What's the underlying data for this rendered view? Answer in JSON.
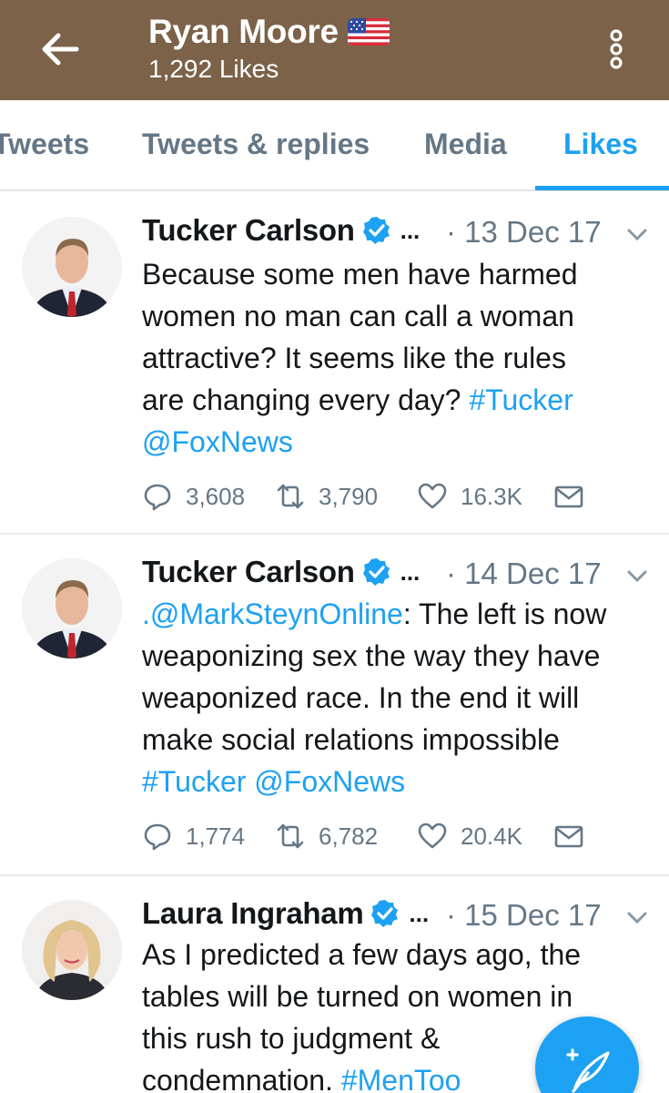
{
  "header": {
    "title": "Ryan Moore",
    "subtitle": "1,292 Likes",
    "flag_icon": "us-flag-emoji",
    "back_icon": "arrow-left-icon",
    "more_icon": "kebab-menu-icon",
    "background_color": "#7b6248"
  },
  "tabs": [
    {
      "label": "Tweets",
      "active": false
    },
    {
      "label": "Tweets & replies",
      "active": false
    },
    {
      "label": "Media",
      "active": false
    },
    {
      "label": "Likes",
      "active": true
    }
  ],
  "colors": {
    "accent": "#1da1f2",
    "muted": "#657786",
    "text": "#14171a"
  },
  "tweets": [
    {
      "author": "Tucker Carlson",
      "verified": true,
      "truncation": "...",
      "date": "· 13 Dec 17",
      "text_lines": [
        "Because some men have harmed",
        "women no man can call a woman",
        "attractive? It seems like the rules",
        "are changing every day? "
      ],
      "hashtag": "#Tucker",
      "mention": "@FoxNews",
      "replies": "3,608",
      "retweets": "3,790",
      "likes": "16.3K"
    },
    {
      "author": "Tucker Carlson",
      "verified": true,
      "truncation": "...",
      "date": "· 14 Dec 17",
      "lead_mention": ".@MarkSteynOnline",
      "text_lines": [
        ": The left is now",
        "weaponizing sex the way they have",
        "weaponized race. In the end it will",
        "make social relations impossible"
      ],
      "hashtag": "#Tucker",
      "mention": "@FoxNews",
      "replies": "1,774",
      "retweets": "6,782",
      "likes": "20.4K"
    },
    {
      "author": "Laura Ingraham",
      "verified": true,
      "truncation": "...",
      "date": "· 15 Dec 17",
      "text_lines": [
        "As I predicted a few days ago, the",
        "tables will be turned on women in",
        "this rush to judgment &",
        "condemnation. "
      ],
      "hashtag": "#MenToo"
    }
  ],
  "fab": {
    "icon": "compose-tweet-icon"
  }
}
